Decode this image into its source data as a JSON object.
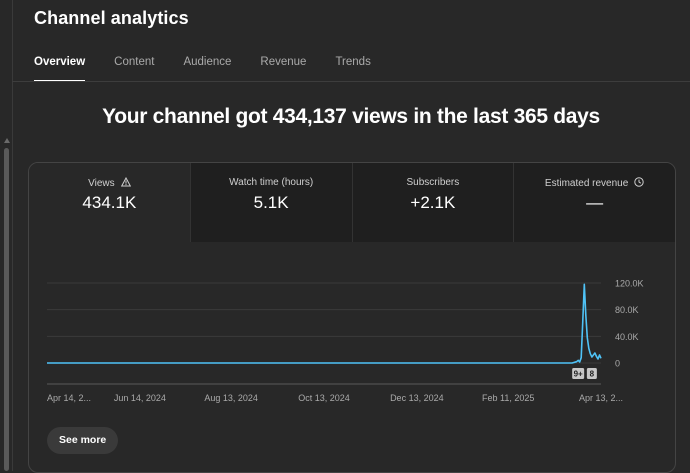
{
  "page": {
    "title": "Channel analytics",
    "headline": "Your channel got 434,137 views in the last 365 days"
  },
  "tabs": [
    {
      "label": "Overview",
      "active": true
    },
    {
      "label": "Content",
      "active": false
    },
    {
      "label": "Audience",
      "active": false
    },
    {
      "label": "Revenue",
      "active": false
    },
    {
      "label": "Trends",
      "active": false
    }
  ],
  "metrics": [
    {
      "label": "Views",
      "value": "434.1K",
      "icon": "warning-icon",
      "selected": true
    },
    {
      "label": "Watch time (hours)",
      "value": "5.1K",
      "icon": "",
      "selected": false
    },
    {
      "label": "Subscribers",
      "value": "+2.1K",
      "icon": "",
      "selected": false
    },
    {
      "label": "Estimated revenue",
      "value": "—",
      "icon": "clock-icon",
      "selected": false
    }
  ],
  "chart_data": {
    "type": "line",
    "x_tick_labels": [
      "Apr 14, 2...",
      "Jun 14, 2024",
      "Aug 13, 2024",
      "Oct 13, 2024",
      "Dec 13, 2024",
      "Feb 11, 2025",
      "Apr 13, 2..."
    ],
    "y_tick_labels": [
      "120.0K",
      "80.0K",
      "40.0K",
      "0"
    ],
    "ylim": [
      0,
      120000
    ],
    "xlim_days": [
      0,
      364
    ],
    "series": [
      {
        "color": "#4fc3f7",
        "x": [
          0,
          100,
          200,
          300,
          340,
          345,
          348,
          349,
          350,
          351,
          352,
          353,
          354,
          355,
          356,
          357,
          358,
          359,
          360,
          361,
          362,
          363,
          364
        ],
        "y": [
          0,
          0,
          0,
          0,
          0,
          0,
          2000,
          4000,
          1500,
          8000,
          60000,
          118000,
          72000,
          38000,
          22000,
          14000,
          9000,
          12000,
          15000,
          10000,
          6000,
          12000,
          7000
        ]
      }
    ],
    "markers": [
      {
        "label": "9+",
        "x": 349
      },
      {
        "label": "8",
        "x": 358
      }
    ],
    "grid": true
  },
  "actions": {
    "see_more": "See more"
  }
}
